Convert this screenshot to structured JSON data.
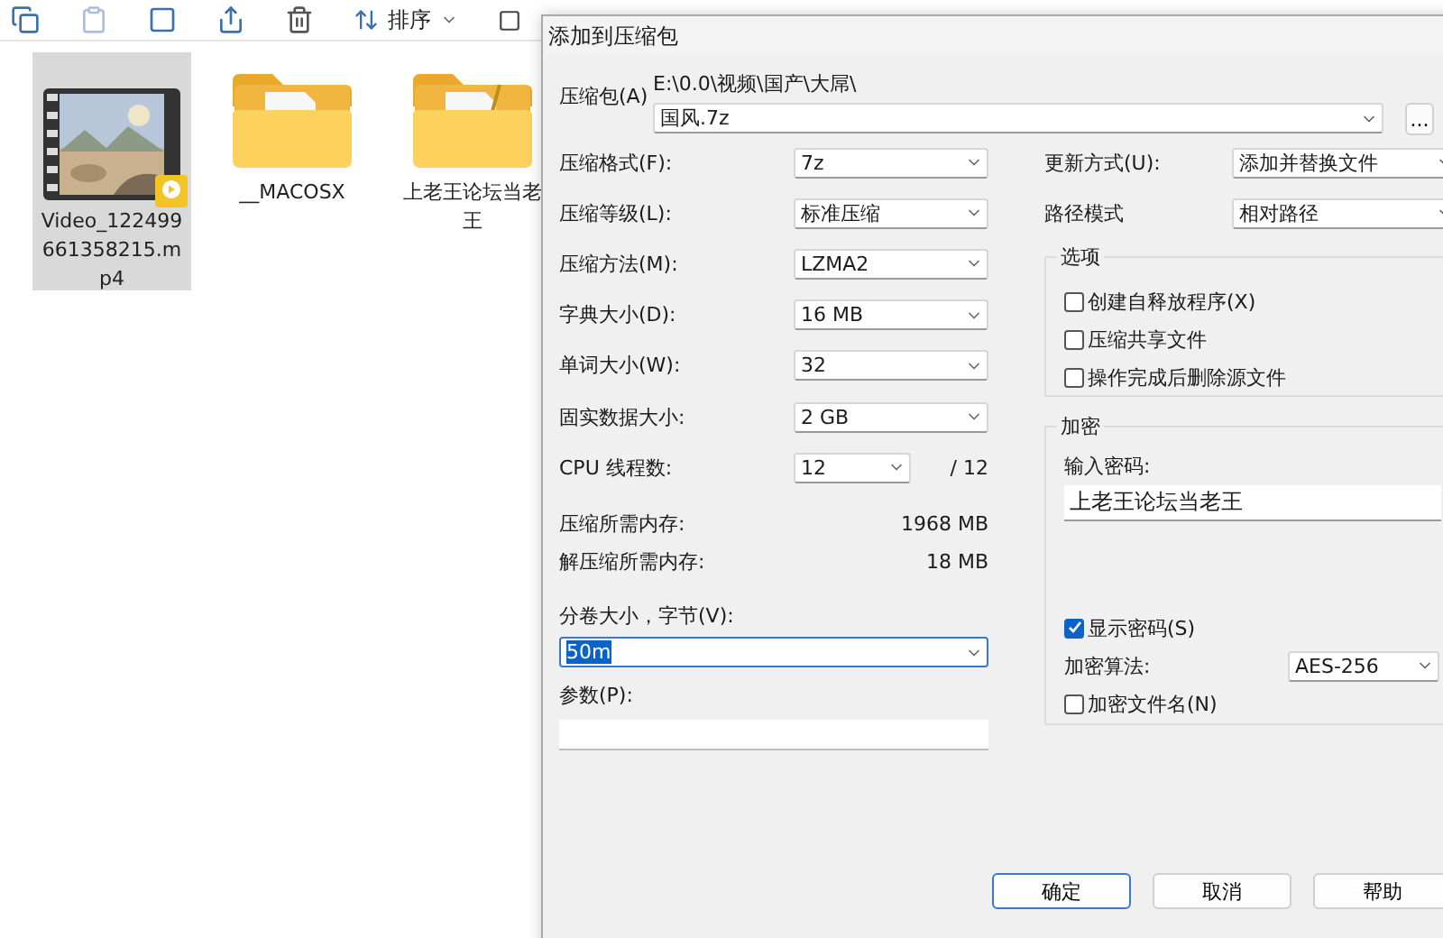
{
  "explorer": {
    "toolbar": {
      "sort": "排序"
    },
    "files": [
      {
        "name": "Video_122499661358215.mp4",
        "kind": "video",
        "selected": true
      },
      {
        "name": "__MACOSX",
        "kind": "folder",
        "selected": false
      },
      {
        "name": "上老王论坛当老王",
        "kind": "folder_doc",
        "selected": false
      }
    ]
  },
  "dialog": {
    "title": "添加到压缩包",
    "archive": {
      "label": "压缩包(A)",
      "path": "E:\\0.0\\视频\\国产\\大屌\\",
      "value": "国风.7z",
      "browse": "..."
    },
    "settings": [
      {
        "kind": "combo",
        "label": "压缩格式(F):",
        "value": "7z"
      },
      {
        "kind": "combo",
        "label": "压缩等级(L):",
        "value": "标准压缩"
      },
      {
        "kind": "combo",
        "label": "压缩方法(M):",
        "value": "LZMA2"
      },
      {
        "kind": "combo",
        "label": "字典大小(D):",
        "value": "16 MB"
      },
      {
        "kind": "combo",
        "label": "单词大小(W):",
        "value": "32"
      },
      {
        "kind": "combo",
        "label": "固实数据大小:",
        "value": "2 GB"
      },
      {
        "kind": "threads",
        "label": "CPU 线程数:",
        "value": "12",
        "suffix": "/ 12"
      },
      {
        "kind": "info",
        "label": "压缩所需内存:",
        "value": "1968 MB"
      },
      {
        "kind": "info",
        "label": "解压缩所需内存:",
        "value": "18 MB"
      }
    ],
    "volume": {
      "label": "分卷大小，字节(V):",
      "value": "50m"
    },
    "params": {
      "label": "参数(P):"
    },
    "update": {
      "label": "更新方式(U):",
      "value": "添加并替换文件"
    },
    "path_mode": {
      "label": "路径模式",
      "value": "相对路径"
    },
    "options": {
      "title": "选项",
      "items": [
        {
          "label": "创建自释放程序(X)",
          "checked": false
        },
        {
          "label": "压缩共享文件",
          "checked": false
        },
        {
          "label": "操作完成后删除源文件",
          "checked": false
        }
      ]
    },
    "encryption": {
      "title": "加密",
      "password_label": "输入密码:",
      "password": "上老王论坛当老王",
      "show_password": {
        "label": "显示密码(S)",
        "checked": true
      },
      "method_label": "加密算法:",
      "method": "AES-256",
      "encrypt_names": {
        "label": "加密文件名(N)",
        "checked": false
      }
    },
    "buttons": [
      {
        "label": "确定",
        "default": true
      },
      {
        "label": "取消",
        "default": false
      },
      {
        "label": "帮助",
        "default": false
      }
    ]
  }
}
